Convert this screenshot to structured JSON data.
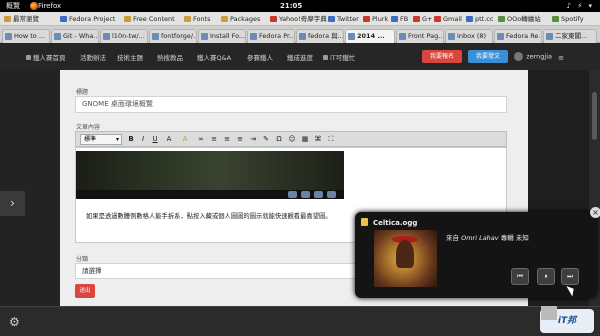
{
  "topbar": {
    "activities": "概覽",
    "browser": "Firefox",
    "clock": "21:05",
    "system": "♪ ⚡ ▾"
  },
  "bookmarks": [
    "最常瀏覽",
    "Fedora Project",
    "Free Content",
    "Fonts",
    "Packages",
    "Yahoo!奇摩字典",
    "Twitter",
    "Plurk",
    "FB",
    "G+",
    "Gmail",
    "ptt.cc",
    "OOo轉繪站",
    "Spotify"
  ],
  "tabs": [
    "How to ...",
    "Git - Wha...",
    "l10n-tw/...",
    "fontforge/...",
    "Install Fo...",
    "Fedora Pr...",
    "fedora 與...",
    "2014 ...",
    "Front Pag...",
    "Inbox (8)",
    "Fedora Re...",
    "二家東閣..."
  ],
  "site_nav": {
    "items": [
      "鐵人賽首頁",
      "活動辦法",
      "技術主題",
      "熱搜教品",
      "鐵人賽Q&A",
      "參賽鐵人",
      "鐵成進度",
      "iT可鐵忙"
    ],
    "btn_red": "我要報名",
    "btn_blue": "我要發文",
    "username": "zerngjia",
    "menu_icon": "≡"
  },
  "form": {
    "title_label": "標題",
    "title_value": "GNOME 桌面環境概覽",
    "body_label": "文章內容",
    "format_select": "標準",
    "toolbar_buttons": [
      "B",
      "I",
      "U",
      "A",
      "A",
      "∞",
      "≡",
      "≡",
      "≡",
      "⇥",
      "✎",
      "Ω",
      "☺",
      "▦",
      "⌘",
      "⛶"
    ],
    "body_text": "如果是透過數體例數格人能手拆系，點按入藏或個人圖圖的圖示就能快速觀看最喜望圖。",
    "category_label": "分類",
    "category_value": "請選擇",
    "small_button": "送出"
  },
  "notification": {
    "title": "Celtica.ogg",
    "meta_prefix": "來自",
    "artist": "Omri Lahav",
    "meta_middle": "專輯",
    "album": "未知",
    "controls": [
      "⏮",
      "⏸",
      "⏭"
    ]
  },
  "bottom": {
    "settings_icon": "⚙",
    "logo_text": "iT邦"
  },
  "side_arrow": "›"
}
